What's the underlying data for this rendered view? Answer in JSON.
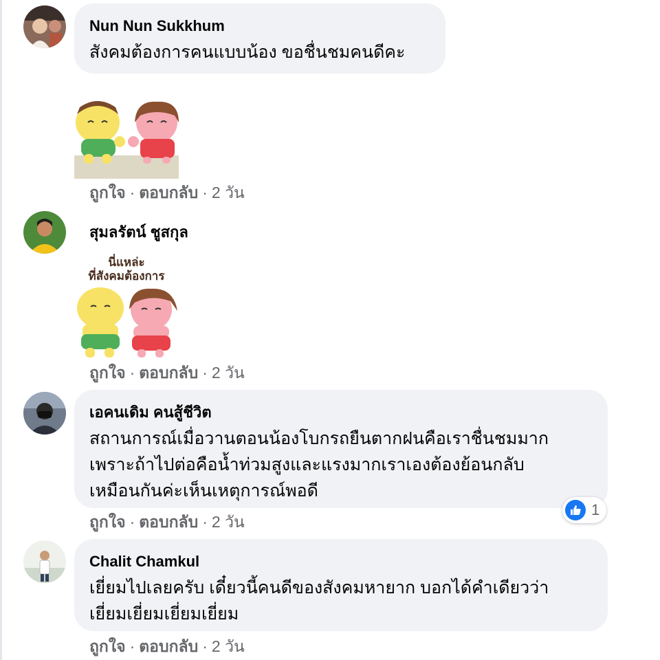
{
  "comments": [
    {
      "author": "Nun Nun Sukkhum",
      "lines": [
        "สังคมต้องการคนแบบน้อง ขอชื่นชมคนดีคะ"
      ],
      "sticker": "hug-sticker",
      "actions": {
        "like": "ถูกใจ",
        "reply": "ตอบกลับ",
        "time": "2 วัน"
      }
    },
    {
      "author": "สุมลรัตน์ ชูสกุล",
      "sticker_caption": [
        "นี่แหล่ะ",
        "ที่สังคมต้องการ"
      ],
      "sticker": "arms-crossed-sticker",
      "actions": {
        "like": "ถูกใจ",
        "reply": "ตอบกลับ",
        "time": "2 วัน"
      }
    },
    {
      "author": "เอคนเดิม คนสู้ชีวิต",
      "lines": [
        "สถานการณ์เมื่อวานตอนน้องโบกรถยืนตากฝนคือเราชื่นชมมาก",
        "เพราะถ้าไปต่อคือน้ำท่วมสูงและแรงมากเราเองต้องย้อนกลับ",
        "เหมือนกันค่ะเห็นเหตุการณ์พอดี"
      ],
      "reactions": {
        "icon": "like-icon",
        "count": "1"
      },
      "actions": {
        "like": "ถูกใจ",
        "reply": "ตอบกลับ",
        "time": "2 วัน"
      }
    },
    {
      "author": "Chalit Chamkul",
      "lines": [
        "เยี่ยมไปเลยครับ เดี๋ยวนี้คนดีของสังคมหายาก บอกได้คำเดียวว่า",
        "เยี่ยมเยี่ยมเยี่ยมเยี่ยม"
      ],
      "actions": {
        "like": "ถูกใจ",
        "reply": "ตอบกลับ",
        "time": "2 วัน"
      }
    }
  ],
  "separator": "·",
  "colors": {
    "bubble": "#f0f2f5",
    "meta": "#65676b",
    "like": "#1877f2"
  }
}
